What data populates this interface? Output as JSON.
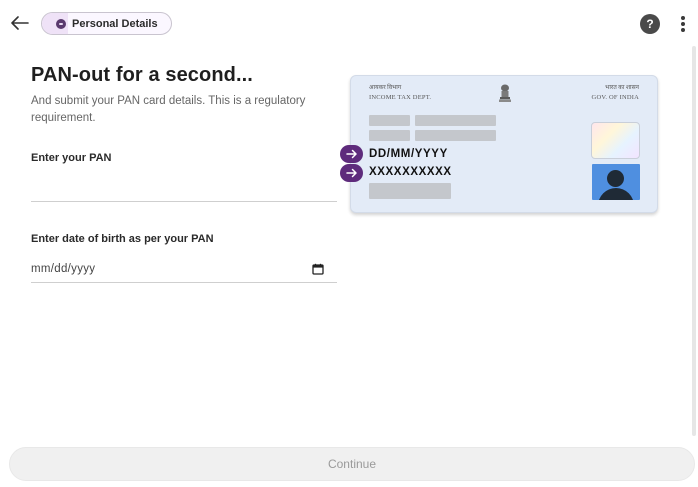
{
  "header": {
    "step_chip_label": "Personal Details",
    "help_symbol": "?"
  },
  "main": {
    "title": "PAN-out for a second...",
    "subtitle": "And submit your PAN card details. This is a regulatory requirement.",
    "pan_field": {
      "label": "Enter your PAN",
      "value": "",
      "placeholder": ""
    },
    "dob_field": {
      "label": "Enter date of birth as per your PAN",
      "value": "mm/dd/yyyy"
    }
  },
  "pan_card": {
    "header_left_hindi": "आयकर विभाग",
    "header_left_english": "INCOME TAX DEPT.",
    "header_right_hindi": "भारत का शासन",
    "header_right_english": "GOV. OF INDIA",
    "dob_sample": "DD/MM/YYYY",
    "pan_sample": "XXXXXXXXXX"
  },
  "footer": {
    "continue_label": "Continue",
    "continue_enabled": false
  },
  "icons": {
    "back": "arrow-left-icon",
    "chip": "person-circle-icon",
    "help": "question-circle-icon",
    "menu": "more-vertical-icon",
    "calendar": "calendar-icon",
    "pointer": "arrow-right-icon",
    "emblem": "national-emblem-icon",
    "photo": "person-silhouette-icon"
  },
  "colors": {
    "accent_purple": "#5e2b7c",
    "chip_background": "#efe2f7",
    "card_background": "#e3ebf7",
    "photo_background": "#4f8fe0",
    "button_disabled_bg": "#f0f0f0",
    "button_disabled_text": "#9a9a9a"
  }
}
